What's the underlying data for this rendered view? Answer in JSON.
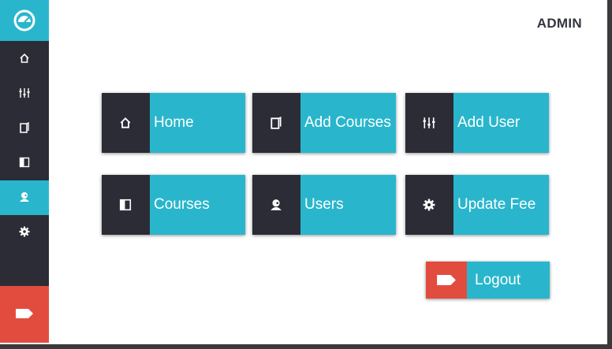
{
  "header": {
    "user_role": "ADMIN"
  },
  "colors": {
    "accent": "#29b6cc",
    "dark": "#2b2c36",
    "danger": "#e24c3f"
  },
  "sidebar": {
    "logo_icon": "dashboard-gauge-icon",
    "items": [
      {
        "icon": "home-icon",
        "active": false
      },
      {
        "icon": "sliders-icon",
        "active": false
      },
      {
        "icon": "door-icon",
        "active": false
      },
      {
        "icon": "book-icon",
        "active": false
      },
      {
        "icon": "user-icon",
        "active": true
      },
      {
        "icon": "gear-icon",
        "active": false
      }
    ],
    "logout_icon": "tag-arrow-icon"
  },
  "tiles": [
    {
      "label": "Home",
      "icon": "home-icon"
    },
    {
      "label": "Add Courses",
      "icon": "door-icon"
    },
    {
      "label": "Add User",
      "icon": "sliders-icon"
    },
    {
      "label": "Courses",
      "icon": "book-icon"
    },
    {
      "label": "Users",
      "icon": "user-icon"
    },
    {
      "label": "Update Fee",
      "icon": "gear-icon"
    }
  ],
  "logout": {
    "label": "Logout",
    "icon": "tag-arrow-icon"
  }
}
